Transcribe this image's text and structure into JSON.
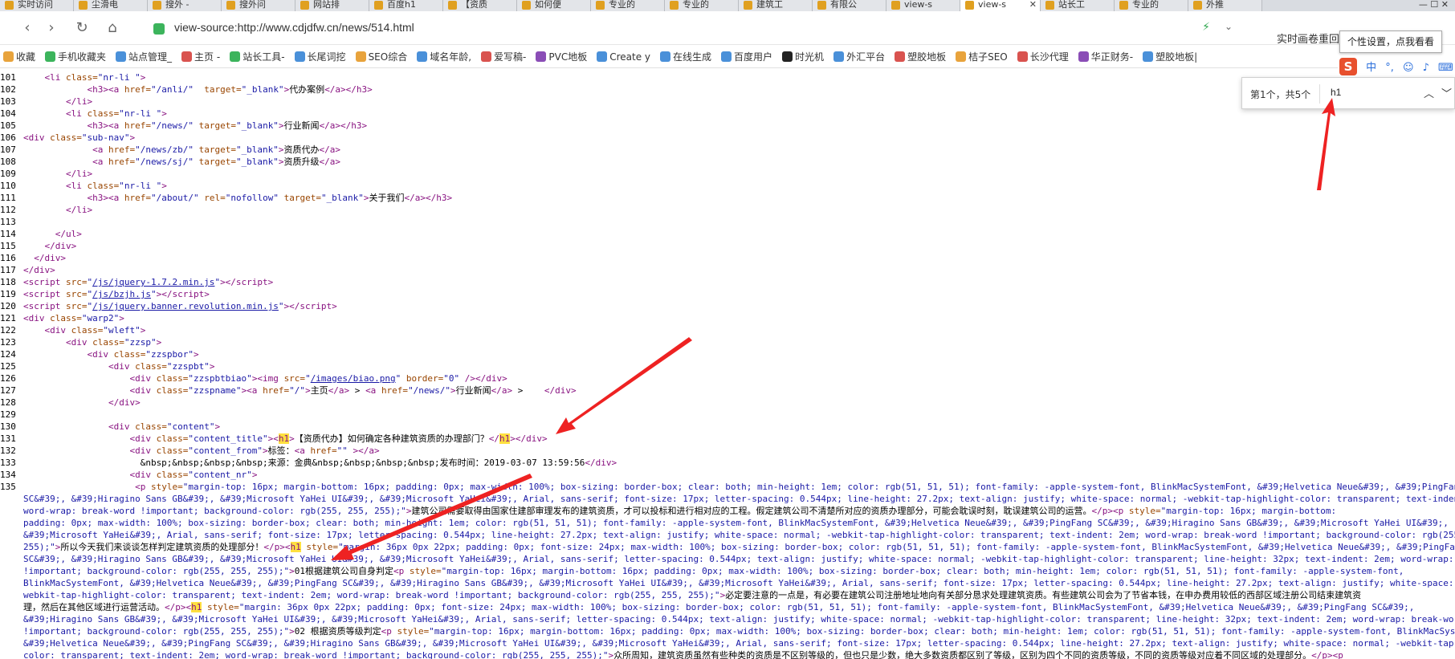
{
  "tabs": [
    {
      "label": "实时访问",
      "active": false
    },
    {
      "label": "尘滑电",
      "active": false
    },
    {
      "label": "搜外 -",
      "active": false
    },
    {
      "label": "搜外问",
      "active": false
    },
    {
      "label": "网站排",
      "active": false
    },
    {
      "label": "百度h1",
      "active": false
    },
    {
      "label": "【资质",
      "active": false
    },
    {
      "label": "如何便",
      "active": false
    },
    {
      "label": "专业的",
      "active": false
    },
    {
      "label": "专业的",
      "active": false
    },
    {
      "label": "建筑工",
      "active": false
    },
    {
      "label": "有限公",
      "active": false
    },
    {
      "label": "view-s",
      "active": false
    },
    {
      "label": "view-s",
      "active": true
    },
    {
      "label": "站长工",
      "active": false
    },
    {
      "label": "专业的",
      "active": false
    },
    {
      "label": "外推",
      "active": false
    }
  ],
  "tab_controls": "—  ☐  ✕",
  "address": {
    "url": "view-source:http://www.cdjdfw.cn/news/514.html",
    "search_hint": "实时画卷重回三国时代"
  },
  "bookmarks": [
    "收藏",
    "手机收藏夹",
    "站点管理_",
    "主页 -",
    "站长工具-",
    "长尾词挖",
    "SEO综合",
    "域名年龄,",
    "爱写稿-",
    "PVC地板",
    "Create y",
    "在线生成",
    "百度用户",
    "时光机",
    "外汇平台",
    "塑胶地板",
    "桔子SEO",
    "长沙代理",
    "华正财务-",
    "塑胶地板|"
  ],
  "tooltip": "个性设置，点我看看",
  "ime": {
    "logo": "S",
    "items": [
      "中",
      "°,",
      "☺",
      "♪",
      "⌨"
    ]
  },
  "find": {
    "count": "第1个，共5个",
    "query": "h1",
    "up": "︿",
    "down": "﹀"
  },
  "lines": [
    {
      "n": "101",
      "html": "    <span class='t'>&lt;li</span> <span class='an'>class=</span><span class='av'>\"nr-li \"</span><span class='t'>&gt;</span>"
    },
    {
      "n": "102",
      "html": "            <span class='t'>&lt;h3&gt;&lt;a</span> <span class='an'>href=</span><span class='av'>\"/anli/\"</span>  <span class='an'>target=</span><span class='av'>\"_blank\"</span><span class='t'>&gt;</span>代办案例<span class='t'>&lt;/a&gt;&lt;/h3&gt;</span>"
    },
    {
      "n": "103",
      "html": "        <span class='t'>&lt;/li&gt;</span>"
    },
    {
      "n": "104",
      "html": "        <span class='t'>&lt;li</span> <span class='an'>class=</span><span class='av'>\"nr-li \"</span><span class='t'>&gt;</span>"
    },
    {
      "n": "105",
      "html": "            <span class='t'>&lt;h3&gt;&lt;a</span> <span class='an'>href=</span><span class='av'>\"/news/\"</span> <span class='an'>target=</span><span class='av'>\"_blank\"</span><span class='t'>&gt;</span>行业新闻<span class='t'>&lt;/a&gt;&lt;/h3&gt;</span>"
    },
    {
      "n": "106",
      "html": "<span class='t'>&lt;div</span> <span class='an'>class=</span><span class='av'>\"sub-nav\"</span><span class='t'>&gt;</span>"
    },
    {
      "n": "107",
      "html": "             <span class='t'>&lt;a</span> <span class='an'>href=</span><span class='av'>\"/news/zb/\"</span> <span class='an'>target=</span><span class='av'>\"_blank\"</span><span class='t'>&gt;</span>资质代办<span class='t'>&lt;/a&gt;</span>"
    },
    {
      "n": "108",
      "html": "             <span class='t'>&lt;a</span> <span class='an'>href=</span><span class='av'>\"/news/sj/\"</span> <span class='an'>target=</span><span class='av'>\"_blank\"</span><span class='t'>&gt;</span>资质升级<span class='t'>&lt;/a&gt;</span>"
    },
    {
      "n": "109",
      "html": "        <span class='t'>&lt;/li&gt;</span>"
    },
    {
      "n": "110",
      "html": "        <span class='t'>&lt;li</span> <span class='an'>class=</span><span class='av'>\"nr-li \"</span><span class='t'>&gt;</span>"
    },
    {
      "n": "111",
      "html": "            <span class='t'>&lt;h3&gt;&lt;a</span> <span class='an'>href=</span><span class='av'>\"/about/\"</span> <span class='an'>rel=</span><span class='av'>\"nofollow\"</span> <span class='an'>target=</span><span class='av'>\"_blank\"</span><span class='t'>&gt;</span>关于我们<span class='t'>&lt;/a&gt;&lt;/h3&gt;</span>"
    },
    {
      "n": "112",
      "html": "        <span class='t'>&lt;/li&gt;</span>"
    },
    {
      "n": "113",
      "html": ""
    },
    {
      "n": "114",
      "html": "      <span class='t'>&lt;/ul&gt;</span>"
    },
    {
      "n": "115",
      "html": "    <span class='t'>&lt;/div&gt;</span>"
    },
    {
      "n": "116",
      "html": "  <span class='t'>&lt;/div&gt;</span>"
    },
    {
      "n": "117",
      "html": "<span class='t'>&lt;/div&gt;</span>"
    },
    {
      "n": "118",
      "html": "<span class='t'>&lt;script</span> <span class='an'>src=</span><span class='av'>\"</span><span class='lk'>/js/jquery-1.7.2.min.js</span><span class='av'>\"</span><span class='t'>&gt;&lt;/script&gt;</span>"
    },
    {
      "n": "119",
      "html": "<span class='t'>&lt;script</span> <span class='an'>src=</span><span class='av'>\"</span><span class='lk'>/js/bzjh.js</span><span class='av'>\"</span><span class='t'>&gt;&lt;/script&gt;</span>"
    },
    {
      "n": "120",
      "html": "<span class='t'>&lt;script</span> <span class='an'>src=</span><span class='av'>\"</span><span class='lk'>/js/jquery.banner.revolution.min.js</span><span class='av'>\"</span><span class='t'>&gt;&lt;/script&gt;</span>"
    },
    {
      "n": "121",
      "html": "<span class='t'>&lt;div</span> <span class='an'>class=</span><span class='av'>\"warp2\"</span><span class='t'>&gt;</span>"
    },
    {
      "n": "122",
      "html": "    <span class='t'>&lt;div</span> <span class='an'>class=</span><span class='av'>\"wleft\"</span><span class='t'>&gt;</span>"
    },
    {
      "n": "123",
      "html": "        <span class='t'>&lt;div</span> <span class='an'>class=</span><span class='av'>\"zzsp\"</span><span class='t'>&gt;</span>"
    },
    {
      "n": "124",
      "html": "            <span class='t'>&lt;div</span> <span class='an'>class=</span><span class='av'>\"zzspbor\"</span><span class='t'>&gt;</span>"
    },
    {
      "n": "125",
      "html": "                <span class='t'>&lt;div</span> <span class='an'>class=</span><span class='av'>\"zzspbt\"</span><span class='t'>&gt;</span>"
    },
    {
      "n": "126",
      "html": "                    <span class='t'>&lt;div</span> <span class='an'>class=</span><span class='av'>\"zzspbtbiao\"</span><span class='t'>&gt;&lt;img</span> <span class='an'>src=</span><span class='av'>\"</span><span class='lk'>/images/biao.png</span><span class='av'>\"</span> <span class='an'>border=</span><span class='av'>\"0\"</span> <span class='t'>/&gt;&lt;/div&gt;</span>"
    },
    {
      "n": "127",
      "html": "                    <span class='t'>&lt;div</span> <span class='an'>class=</span><span class='av'>\"zzspname\"</span><span class='t'>&gt;&lt;a</span> <span class='an'>href=</span><span class='av'>\"/\"</span><span class='t'>&gt;</span>主页<span class='t'>&lt;/a&gt;</span> &gt; <span class='t'>&lt;a</span> <span class='an'>href=</span><span class='av'>\"/news/\"</span><span class='t'>&gt;</span>行业新闻<span class='t'>&lt;/a&gt;</span> &gt;    <span class='t'>&lt;/div&gt;</span>"
    },
    {
      "n": "128",
      "html": "                <span class='t'>&lt;/div&gt;</span>"
    },
    {
      "n": "129",
      "html": ""
    },
    {
      "n": "130",
      "html": "                <span class='t'>&lt;div</span> <span class='an'>class=</span><span class='av'>\"content\"</span><span class='t'>&gt;</span>"
    },
    {
      "n": "131",
      "html": "                    <span class='t'>&lt;div</span> <span class='an'>class=</span><span class='av'>\"content_title\"</span><span class='t'>&gt;&lt;<span class='hl'>h1</span>&gt;</span>【资质代办】如何确定各种建筑资质的办理部门？<span class='t'>&lt;/<span class='hl'>h1</span>&gt;&lt;/div&gt;</span>"
    },
    {
      "n": "132",
      "html": "                    <span class='t'>&lt;div</span> <span class='an'>class=</span><span class='av'>\"content_from\"</span><span class='t'>&gt;</span>标签：<span class='t'>&lt;a</span> <span class='an'>href=</span><span class='av'>\"\"</span> <span class='t'>&gt;&lt;/a&gt;</span>"
    },
    {
      "n": "133",
      "html": "                      &amp;nbsp;&amp;nbsp;&amp;nbsp;&amp;nbsp;来源：金典&amp;nbsp;&amp;nbsp;&amp;nbsp;&amp;nbsp;发布时间：2019-03-07 13:59:56<span class='t'>&lt;/div&gt;</span>"
    },
    {
      "n": "134",
      "html": "                    <span class='t'>&lt;div</span> <span class='an'>class=</span><span class='av'>\"content_nr\"</span><span class='t'>&gt;</span>"
    },
    {
      "n": "135",
      "html": "                     <span class='t'>&lt;p</span> <span class='an'>style=</span><span class='av'>\"margin-top: 16px; margin-bottom: 16px; padding: 0px; max-width: 100%; box-sizing: border-box; clear: both; min-height: 1em; color: rgb(51, 51, 51); font-family: -apple-system-font, BlinkMacSystemFont, &amp;#39;Helvetica Neue&amp;#39;, &amp;#39;PingFang</span>"
    },
    {
      "n": "",
      "html": "<span class='av'>SC&amp;#39;, &amp;#39;Hiragino Sans GB&amp;#39;, &amp;#39;Microsoft YaHei UI&amp;#39;, &amp;#39;Microsoft YaHei&amp;#39;, Arial, sans-serif; font-size: 17px; letter-spacing: 0.544px; line-height: 27.2px; text-align: justify; white-space: normal; -webkit-tap-highlight-color: transparent; text-indent: 2em;</span>"
    },
    {
      "n": "",
      "html": "<span class='av'>word-wrap: break-word !important; background-color: rgb(255, 255, 255);\"</span><span class='t'>&gt;</span>建筑公司需要取得由国家住建部审理发布的建筑资质，才可以投标和进行相对应的工程。假定建筑公司不清楚所对应的资质办理部分，可能会耽误时刻，耽误建筑公司的运营。<span class='t'>&lt;/p&gt;&lt;p</span> <span class='an'>style=</span><span class='av'>\"margin-top: 16px; margin-bottom:</span>"
    },
    {
      "n": "",
      "html": "<span class='av'>padding: 0px; max-width: 100%; box-sizing: border-box; clear: both; min-height: 1em; color: rgb(51, 51, 51); font-family: -apple-system-font, BlinkMacSystemFont, &amp;#39;Helvetica Neue&amp;#39;, &amp;#39;PingFang SC&amp;#39;, &amp;#39;Hiragino Sans GB&amp;#39;, &amp;#39;Microsoft YaHei UI&amp;#39;,</span>"
    },
    {
      "n": "",
      "html": "<span class='av'>&amp;#39;Microsoft YaHei&amp;#39;, Arial, sans-serif; font-size: 17px; letter-spacing: 0.544px; line-height: 27.2px; text-align: justify; white-space: normal; -webkit-tap-highlight-color: transparent; text-indent: 2em; word-wrap: break-word !important; background-color: rgb(255, 255,</span>"
    },
    {
      "n": "",
      "html": "<span class='av'>255);\"</span><span class='t'>&gt;</span>所以今天我们来谈谈怎样判定建筑资质的处理部分！<span class='t'>&lt;/p&gt;&lt;<span class='hl'>h1</span></span> <span class='an'>style=</span><span class='av'>\"margin: 36px 0px 22px; padding: 0px; font-size: 24px; max-width: 100%; box-sizing: border-box; color: rgb(51, 51, 51); font-family: -apple-system-font, BlinkMacSystemFont, &amp;#39;Helvetica Neue&amp;#39;, &amp;#39;PingFang</span>"
    },
    {
      "n": "",
      "html": "<span class='av'>SC&amp;#39;, &amp;#39;Hiragino Sans GB&amp;#39;, &amp;#39;Microsoft YaHei UI&amp;#39;, &amp;#39;Microsoft YaHei&amp;#39;, Arial, sans-serif; letter-spacing: 0.544px; text-align: justify; white-space: normal; -webkit-tap-highlight-color: transparent; line-height: 32px; text-indent: 2em; word-wrap: break-word</span>"
    },
    {
      "n": "",
      "html": "<span class='av'>!important; background-color: rgb(255, 255, 255);\"</span><span class='t'>&gt;</span>01根据建筑公司自身判定<span class='t'>&lt;p</span> <span class='an'>style=</span><span class='av'>\"margin-top: 16px; margin-bottom: 16px; padding: 0px; max-width: 100%; box-sizing: border-box; clear: both; min-height: 1em; color: rgb(51, 51, 51); font-family: -apple-system-font,</span>"
    },
    {
      "n": "",
      "html": "<span class='av'>BlinkMacSystemFont, &amp;#39;Helvetica Neue&amp;#39;, &amp;#39;PingFang SC&amp;#39;, &amp;#39;Hiragino Sans GB&amp;#39;, &amp;#39;Microsoft YaHei UI&amp;#39;, &amp;#39;Microsoft YaHei&amp;#39;, Arial, sans-serif; font-size: 17px; letter-spacing: 0.544px; line-height: 27.2px; text-align: justify; white-space: normal;</span>"
    },
    {
      "n": "",
      "html": "<span class='av'>webkit-tap-highlight-color: transparent; text-indent: 2em; word-wrap: break-word !important; background-color: rgb(255, 255, 255);\"</span><span class='t'>&gt;</span>必定要注意的一点是，有必要在建筑公司注册地址地向有关部分恳求处理建筑资质。有些建筑公司会为了节省本钱，在申办费用较低的西部区域注册公司结束建筑资</span>"
    },
    {
      "n": "",
      "html": "理，然后在其他区域进行运营活动。<span class='t'>&lt;/p&gt;&lt;<span class='hl'>h1</span></span> <span class='an'>style=</span><span class='av'>\"margin: 36px 0px 22px; padding: 0px; font-size: 24px; max-width: 100%; box-sizing: border-box; color: rgb(51, 51, 51); font-family: -apple-system-font, BlinkMacSystemFont, &amp;#39;Helvetica Neue&amp;#39;, &amp;#39;PingFang SC&amp;#39;,</span>"
    },
    {
      "n": "",
      "html": "<span class='av'>&amp;#39;Hiragino Sans GB&amp;#39;, &amp;#39;Microsoft YaHei UI&amp;#39;, &amp;#39;Microsoft YaHei&amp;#39;, Arial, sans-serif; letter-spacing: 0.544px; text-align: justify; white-space: normal; -webkit-tap-highlight-color: transparent; line-height: 32px; text-indent: 2em; word-wrap: break-word</span>"
    },
    {
      "n": "",
      "html": "<span class='av'>!important; background-color: rgb(255, 255, 255);\"</span><span class='t'>&gt;</span>02 根据资质等级判定<span class='t'>&lt;p</span> <span class='an'>style=</span><span class='av'>\"margin-top: 16px; margin-bottom: 16px; padding: 0px; max-width: 100%; box-sizing: border-box; clear: both; min-height: 1em; color: rgb(51, 51, 51); font-family: -apple-system-font, BlinkMacSyster</span>"
    },
    {
      "n": "",
      "html": "<span class='av'>&amp;#39;Helvetica Neue&amp;#39;, &amp;#39;PingFang SC&amp;#39;, &amp;#39;Hiragino Sans GB&amp;#39;, &amp;#39;Microsoft YaHei UI&amp;#39;, &amp;#39;Microsoft YaHei&amp;#39;, Arial, sans-serif; font-size: 17px; letter-spacing: 0.544px; line-height: 27.2px; text-align: justify; white-space: normal; -webkit-tap-high</span>"
    },
    {
      "n": "",
      "html": "<span class='av'>color: transparent; text-indent: 2em; word-wrap: break-word !important; background-color: rgb(255, 255, 255);\"</span><span class='t'>&gt;</span>众所周知，建筑资质虽然有些种类的资质是不区别等级的，但也只是少数，绝大多数资质都区别了等级，区别为四个不同的资质等级，不同的资质等级对应着不同区域的处理部分。<span class='t'>&lt;/p&gt;&lt;p</span>"
    }
  ]
}
